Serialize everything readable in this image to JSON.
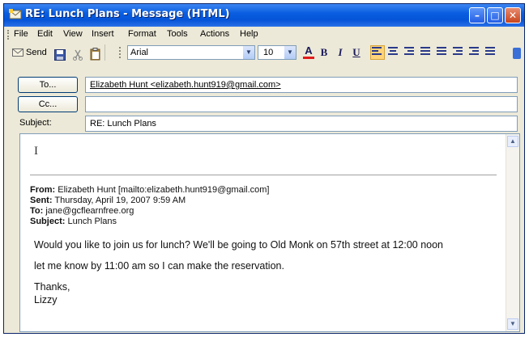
{
  "window": {
    "title": "RE: Lunch Plans - Message (HTML)",
    "min_glyph": "–",
    "max_glyph": "□",
    "close_glyph": "✕"
  },
  "menu": {
    "items": [
      "File",
      "Edit",
      "View",
      "Insert",
      "Format",
      "Tools",
      "Actions",
      "Help"
    ]
  },
  "toolbar": {
    "send_label": "Send",
    "font_name": "Arial",
    "font_size": "10",
    "bold": "B",
    "italic": "I",
    "underline": "U",
    "font_color_glyph": "A"
  },
  "header": {
    "to_button": "To...",
    "to_value": "Elizabeth Hunt <elizabeth.hunt919@gmail.com>",
    "cc_button": "Cc...",
    "cc_value": "",
    "subject_label": "Subject:",
    "subject_value": "RE: Lunch Plans"
  },
  "body": {
    "cursor": "I",
    "from_label": "From:",
    "from_value": "Elizabeth Hunt [mailto:elizabeth.hunt919@gmail.com]",
    "sent_label": "Sent:",
    "sent_value": "Thursday, April 19, 2007 9:59 AM",
    "to_label": "To:",
    "to_value": "jane@gcflearnfree.org",
    "subject_label": "Subject:",
    "subject_value": "Lunch Plans",
    "line1": "Would you like to join us for  lunch? We'll be going to Old Monk on 57th street at 12:00 noon",
    "line2": "let me know by  11:00 am  so I can make the reservation.",
    "line3": "Thanks,",
    "line4": "Lizzy"
  },
  "colors": {
    "titlebar": "#0554d8",
    "window_bg": "#ece9d8",
    "field_border": "#7f9db9"
  }
}
